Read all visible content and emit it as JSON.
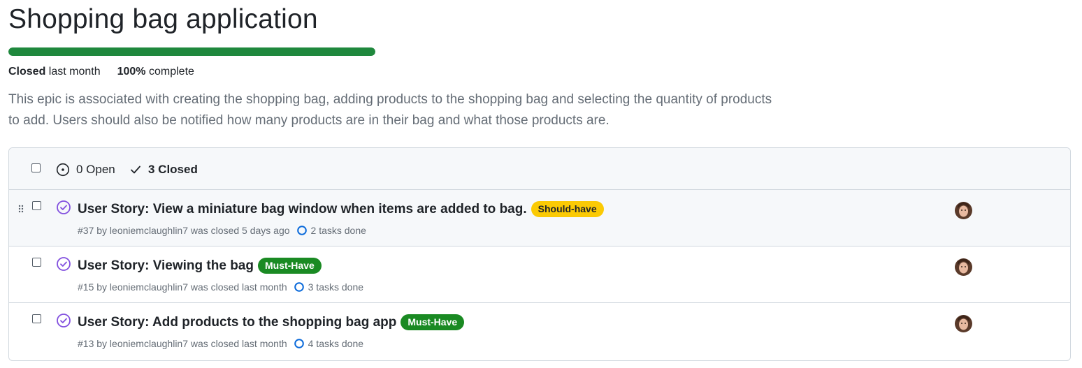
{
  "milestone": {
    "title": "Shopping bag application",
    "progress_percent": 100,
    "status_label": "Closed",
    "status_time": "last month",
    "complete_value": "100%",
    "complete_label": "complete",
    "description": "This epic is associated with creating the shopping bag, adding products to the shopping bag and selecting the quantity of products to add. Users should also be notified how many products are in their bag and what those products are."
  },
  "filters": {
    "open_label": "0 Open",
    "closed_label": "3 Closed"
  },
  "colors": {
    "progress": "#1f883d",
    "closed_purple": "#8250df",
    "task_blue": "#0969da",
    "should_have": "#fbca04",
    "must_have": "#1a8a23"
  },
  "issues": [
    {
      "title": "User Story: View a miniature bag window when items are added to bag.",
      "label": "Should-have",
      "meta": "#37 by leoniemclaughlin7 was closed 5 days ago",
      "tasks": "2 tasks done",
      "icon": "issue-closed-icon"
    },
    {
      "title": "User Story: Viewing the bag",
      "label": "Must-Have",
      "meta": "#15 by leoniemclaughlin7 was closed last month",
      "tasks": "3 tasks done",
      "icon": "issue-closed-icon"
    },
    {
      "title": "User Story: Add products to the shopping bag app",
      "label": "Must-Have",
      "meta": "#13 by leoniemclaughlin7 was closed last month",
      "tasks": "4 tasks done",
      "icon": "issue-closed-icon"
    }
  ]
}
